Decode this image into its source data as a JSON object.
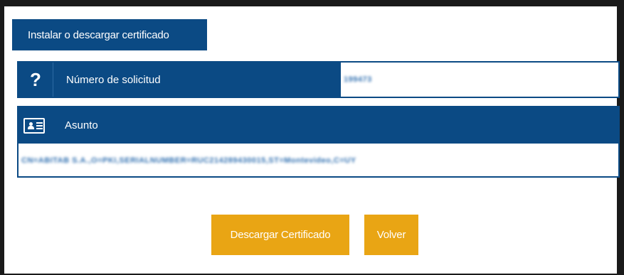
{
  "tab": {
    "label": "Instalar o descargar certificado"
  },
  "solicitud": {
    "label": "Número de solicitud",
    "value": "199473"
  },
  "asunto": {
    "label": "Asunto",
    "value": "CN=ABITAB S.A.,O=PKI,SERIALNUMBER=RUC214289430015,ST=Montevideo,C=UY"
  },
  "buttons": {
    "download": "Descargar Certificado",
    "back": "Volver"
  },
  "icons": {
    "question": "question-icon",
    "card": "id-card-icon"
  },
  "colors": {
    "primary": "#0b4a84",
    "accent": "#e9a514",
    "value_text": "#2f6fb0"
  }
}
